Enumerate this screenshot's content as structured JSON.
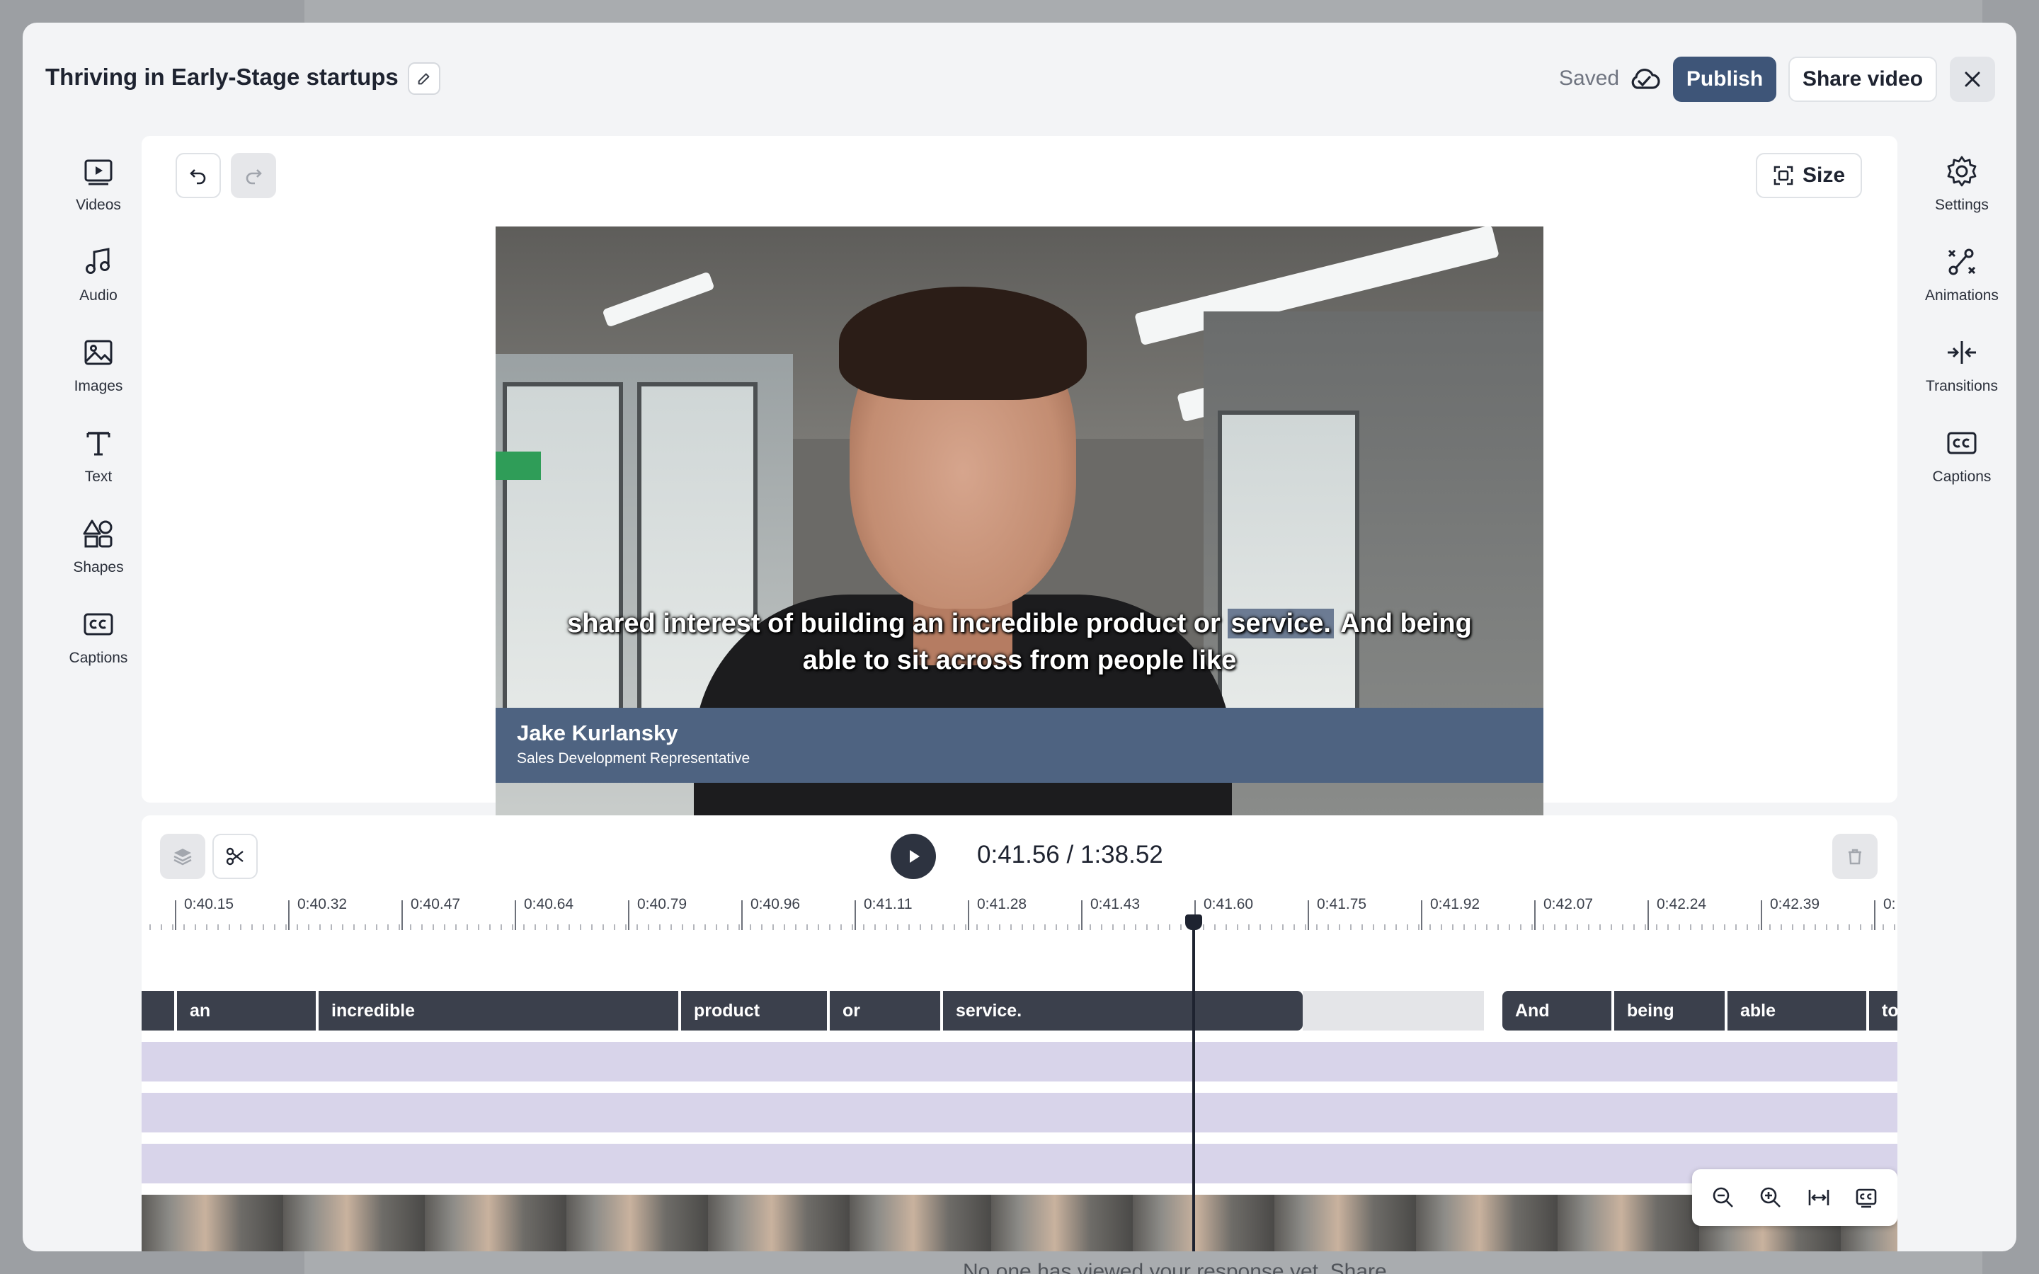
{
  "header": {
    "title": "Thriving in Early-Stage startups",
    "saved_label": "Saved",
    "publish_label": "Publish",
    "share_label": "Share video"
  },
  "left_rail": [
    {
      "label": "Videos",
      "icon": "video-play-icon"
    },
    {
      "label": "Audio",
      "icon": "music-note-icon"
    },
    {
      "label": "Images",
      "icon": "image-icon"
    },
    {
      "label": "Text",
      "icon": "text-t-icon"
    },
    {
      "label": "Shapes",
      "icon": "shapes-icon"
    },
    {
      "label": "Captions",
      "icon": "cc-icon"
    }
  ],
  "right_rail": [
    {
      "label": "Settings",
      "icon": "gear-icon"
    },
    {
      "label": "Animations",
      "icon": "animations-icon"
    },
    {
      "label": "Transitions",
      "icon": "transitions-icon"
    },
    {
      "label": "Captions",
      "icon": "cc-icon"
    }
  ],
  "canvas": {
    "size_label": "Size",
    "caption": {
      "line1_before": "shared interest of building an incredible product or ",
      "line1_highlight": "service.",
      "line1_after": " And being",
      "line2": "able to sit across from people like"
    },
    "lower_third": {
      "name": "Jake Kurlansky",
      "role": "Sales Development Representative"
    }
  },
  "timeline": {
    "current_time": "0:41.56",
    "separator": "/",
    "total_time": "1:38.52",
    "ticks": [
      "0:40.15",
      "0:40.32",
      "0:40.47",
      "0:40.64",
      "0:40.79",
      "0:40.96",
      "0:41.11",
      "0:41.28",
      "0:41.43",
      "0:41.60",
      "0:41.75",
      "0:41.92",
      "0:42.07",
      "0:42.24",
      "0:42.39",
      "0:"
    ],
    "words": [
      "an",
      "incredible",
      "product",
      "or",
      "service.",
      "And",
      "being",
      "able",
      "to"
    ]
  },
  "background": {
    "text": "No one has viewed your response yet. Share"
  },
  "colors": {
    "accent": "#3e5578",
    "lower_third": "#4e6381",
    "word_clip": "#3b404c",
    "lane": "#d8d4ea"
  }
}
